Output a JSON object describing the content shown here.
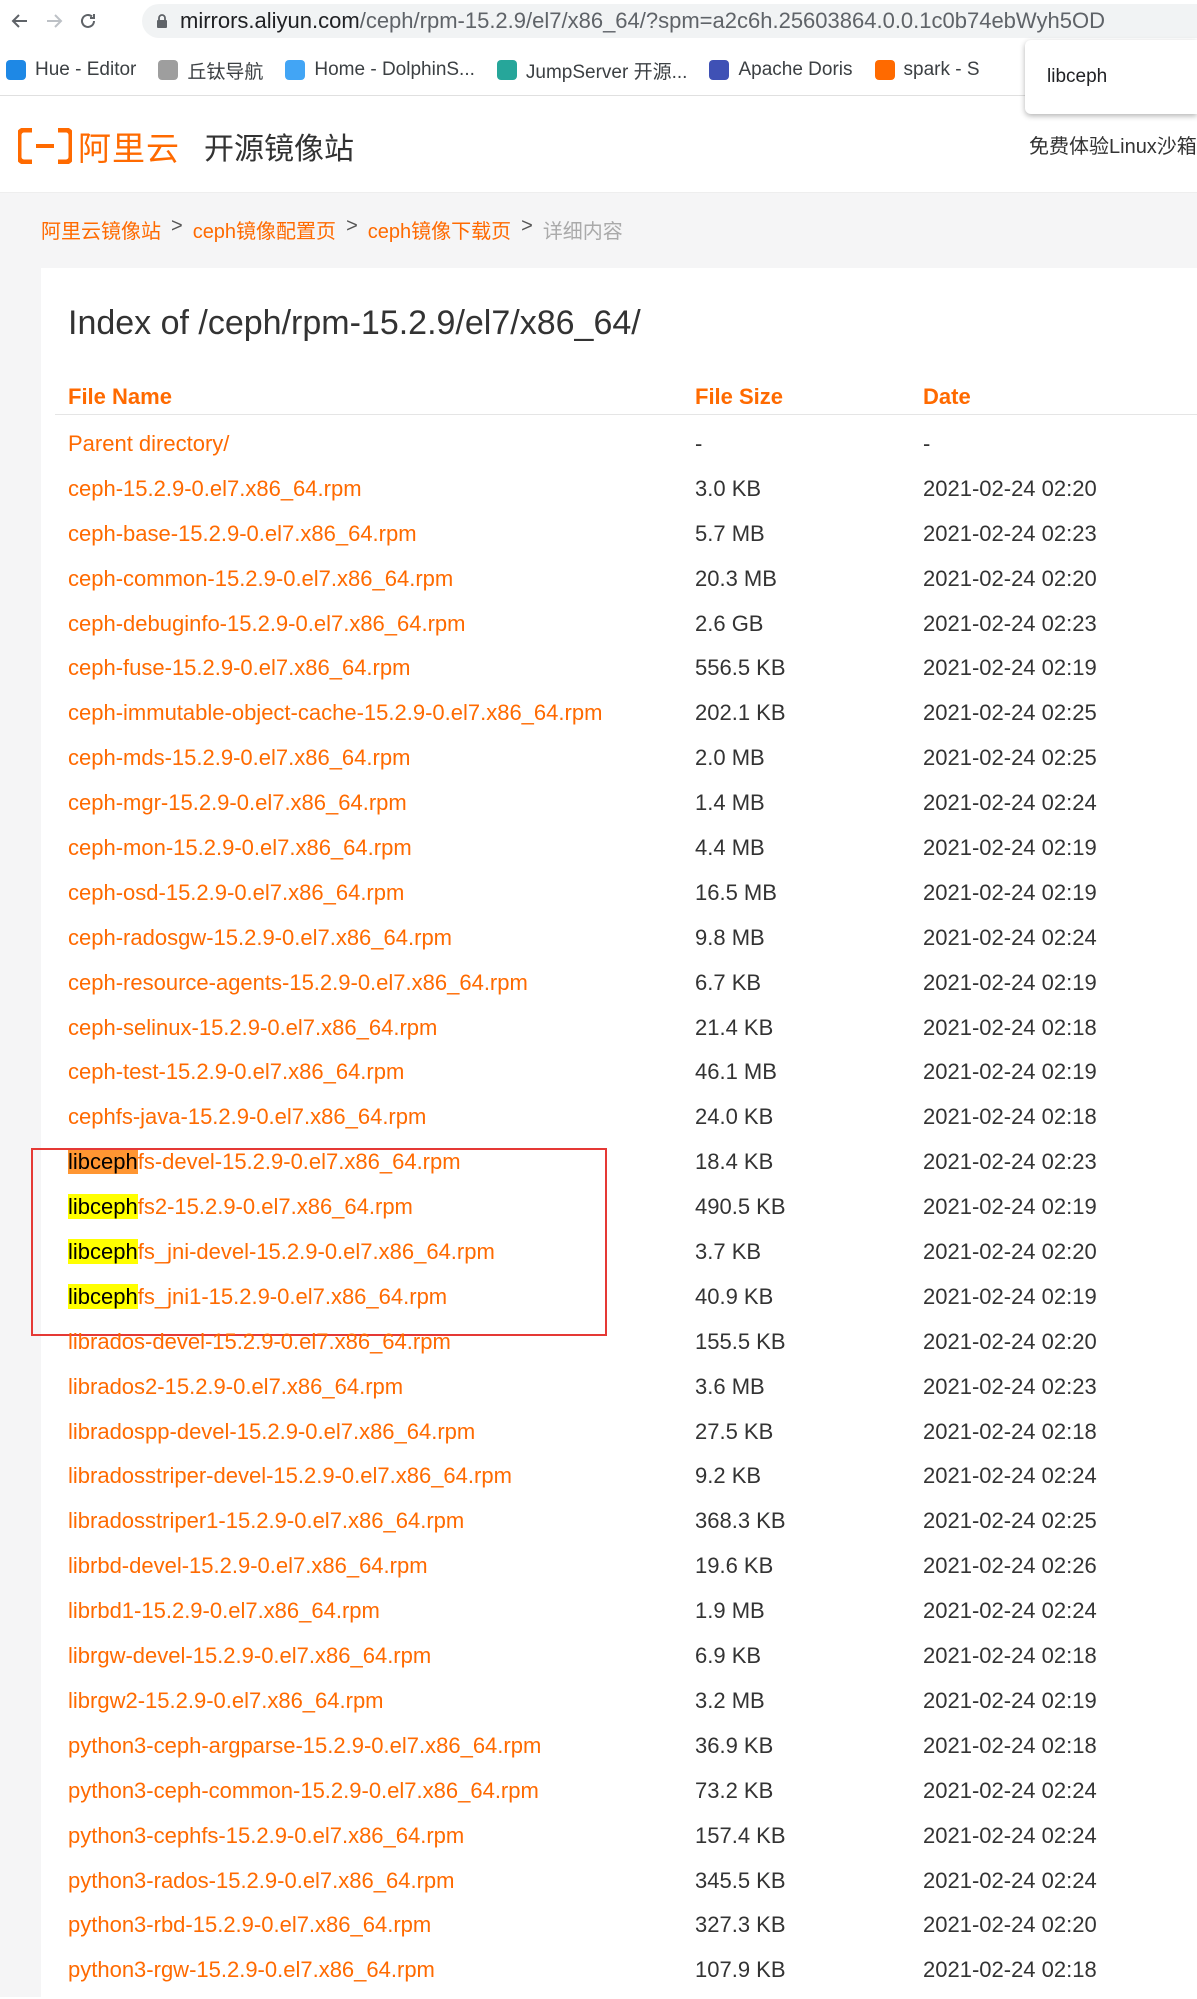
{
  "browser": {
    "url_host": "mirrors.aliyun.com",
    "url_path": "/ceph/rpm-15.2.9/el7/x86_64/?spm=a2c6h.25603864.0.0.1c0b74ebWyh5OD",
    "bookmarks": [
      {
        "label": "Hue - Editor",
        "icon": "hue-icon",
        "color": "#1e88e5"
      },
      {
        "label": "丘钛导航",
        "icon": "globe-icon",
        "color": "#9e9e9e"
      },
      {
        "label": "Home - DolphinS...",
        "icon": "dolphin-icon",
        "color": "#42a5f5"
      },
      {
        "label": "JumpServer 开源...",
        "icon": "jumpserver-icon",
        "color": "#26a69a"
      },
      {
        "label": "Apache Doris",
        "icon": "doris-icon",
        "color": "#3f51b5"
      },
      {
        "label": "spark - S",
        "icon": "spark-icon",
        "color": "#ff6a00"
      }
    ],
    "find_query": "libceph"
  },
  "site": {
    "logo_text": "阿里云",
    "title": "开源镜像站",
    "promo": "免费体验Linux沙箱",
    "brand_color": "#ff6a00"
  },
  "breadcrumb": {
    "items": [
      "阿里云镜像站",
      "ceph镜像配置页",
      "ceph镜像下载页"
    ],
    "current": "详细内容",
    "separator": ">"
  },
  "listing": {
    "title": "Index of /ceph/rpm-15.2.9/el7/x86_64/",
    "headers": {
      "name": "File Name",
      "size": "File Size",
      "date": "Date"
    },
    "rows": [
      {
        "name": "Parent directory/",
        "size": "-",
        "date": "-"
      },
      {
        "name": "ceph-15.2.9-0.el7.x86_64.rpm",
        "size": "3.0 KB",
        "date": "2021-02-24 02:20"
      },
      {
        "name": "ceph-base-15.2.9-0.el7.x86_64.rpm",
        "size": "5.7 MB",
        "date": "2021-02-24 02:23"
      },
      {
        "name": "ceph-common-15.2.9-0.el7.x86_64.rpm",
        "size": "20.3 MB",
        "date": "2021-02-24 02:20"
      },
      {
        "name": "ceph-debuginfo-15.2.9-0.el7.x86_64.rpm",
        "size": "2.6 GB",
        "date": "2021-02-24 02:23"
      },
      {
        "name": "ceph-fuse-15.2.9-0.el7.x86_64.rpm",
        "size": "556.5 KB",
        "date": "2021-02-24 02:19"
      },
      {
        "name": "ceph-immutable-object-cache-15.2.9-0.el7.x86_64.rpm",
        "size": "202.1 KB",
        "date": "2021-02-24 02:25"
      },
      {
        "name": "ceph-mds-15.2.9-0.el7.x86_64.rpm",
        "size": "2.0 MB",
        "date": "2021-02-24 02:25"
      },
      {
        "name": "ceph-mgr-15.2.9-0.el7.x86_64.rpm",
        "size": "1.4 MB",
        "date": "2021-02-24 02:24"
      },
      {
        "name": "ceph-mon-15.2.9-0.el7.x86_64.rpm",
        "size": "4.4 MB",
        "date": "2021-02-24 02:19"
      },
      {
        "name": "ceph-osd-15.2.9-0.el7.x86_64.rpm",
        "size": "16.5 MB",
        "date": "2021-02-24 02:19"
      },
      {
        "name": "ceph-radosgw-15.2.9-0.el7.x86_64.rpm",
        "size": "9.8 MB",
        "date": "2021-02-24 02:24"
      },
      {
        "name": "ceph-resource-agents-15.2.9-0.el7.x86_64.rpm",
        "size": "6.7 KB",
        "date": "2021-02-24 02:19"
      },
      {
        "name": "ceph-selinux-15.2.9-0.el7.x86_64.rpm",
        "size": "21.4 KB",
        "date": "2021-02-24 02:18"
      },
      {
        "name": "ceph-test-15.2.9-0.el7.x86_64.rpm",
        "size": "46.1 MB",
        "date": "2021-02-24 02:19"
      },
      {
        "name": "cephfs-java-15.2.9-0.el7.x86_64.rpm",
        "size": "24.0 KB",
        "date": "2021-02-24 02:18"
      },
      {
        "name": "libcephfs-devel-15.2.9-0.el7.x86_64.rpm",
        "size": "18.4 KB",
        "date": "2021-02-24 02:23",
        "match": "active"
      },
      {
        "name": "libcephfs2-15.2.9-0.el7.x86_64.rpm",
        "size": "490.5 KB",
        "date": "2021-02-24 02:19",
        "match": "yes"
      },
      {
        "name": "libcephfs_jni-devel-15.2.9-0.el7.x86_64.rpm",
        "size": "3.7 KB",
        "date": "2021-02-24 02:20",
        "match": "yes"
      },
      {
        "name": "libcephfs_jni1-15.2.9-0.el7.x86_64.rpm",
        "size": "40.9 KB",
        "date": "2021-02-24 02:19",
        "match": "yes"
      },
      {
        "name": "librados-devel-15.2.9-0.el7.x86_64.rpm",
        "size": "155.5 KB",
        "date": "2021-02-24 02:20"
      },
      {
        "name": "librados2-15.2.9-0.el7.x86_64.rpm",
        "size": "3.6 MB",
        "date": "2021-02-24 02:23"
      },
      {
        "name": "libradospp-devel-15.2.9-0.el7.x86_64.rpm",
        "size": "27.5 KB",
        "date": "2021-02-24 02:18"
      },
      {
        "name": "libradosstriper-devel-15.2.9-0.el7.x86_64.rpm",
        "size": "9.2 KB",
        "date": "2021-02-24 02:24"
      },
      {
        "name": "libradosstriper1-15.2.9-0.el7.x86_64.rpm",
        "size": "368.3 KB",
        "date": "2021-02-24 02:25"
      },
      {
        "name": "librbd-devel-15.2.9-0.el7.x86_64.rpm",
        "size": "19.6 KB",
        "date": "2021-02-24 02:26"
      },
      {
        "name": "librbd1-15.2.9-0.el7.x86_64.rpm",
        "size": "1.9 MB",
        "date": "2021-02-24 02:24"
      },
      {
        "name": "librgw-devel-15.2.9-0.el7.x86_64.rpm",
        "size": "6.9 KB",
        "date": "2021-02-24 02:18"
      },
      {
        "name": "librgw2-15.2.9-0.el7.x86_64.rpm",
        "size": "3.2 MB",
        "date": "2021-02-24 02:19"
      },
      {
        "name": "python3-ceph-argparse-15.2.9-0.el7.x86_64.rpm",
        "size": "36.9 KB",
        "date": "2021-02-24 02:18"
      },
      {
        "name": "python3-ceph-common-15.2.9-0.el7.x86_64.rpm",
        "size": "73.2 KB",
        "date": "2021-02-24 02:24"
      },
      {
        "name": "python3-cephfs-15.2.9-0.el7.x86_64.rpm",
        "size": "157.4 KB",
        "date": "2021-02-24 02:24"
      },
      {
        "name": "python3-rados-15.2.9-0.el7.x86_64.rpm",
        "size": "345.5 KB",
        "date": "2021-02-24 02:24"
      },
      {
        "name": "python3-rbd-15.2.9-0.el7.x86_64.rpm",
        "size": "327.3 KB",
        "date": "2021-02-24 02:20"
      },
      {
        "name": "python3-rgw-15.2.9-0.el7.x86_64.rpm",
        "size": "107.9 KB",
        "date": "2021-02-24 02:18"
      }
    ]
  }
}
